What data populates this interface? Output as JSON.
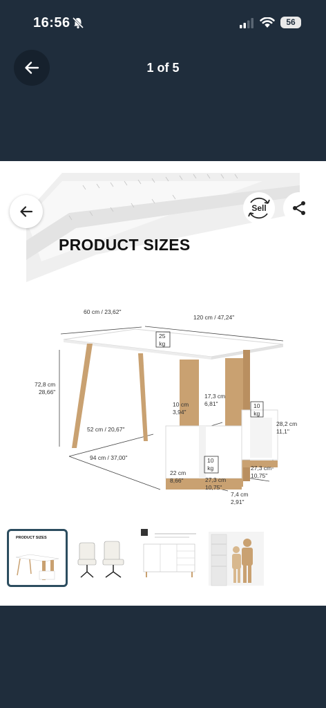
{
  "status_bar": {
    "time": "16:56",
    "battery": "56"
  },
  "header": {
    "counter": "1 of 5"
  },
  "image": {
    "title": "PRODUCT SIZES",
    "sell_label": "Sell",
    "dimensions": [
      "60 cm / 23,62\"",
      "120 cm / 47,24\"",
      "25\nkg",
      "72,8 cm\n28,66\"",
      "10 cm\n3,94\"",
      "17,3 cm\n6,81\"",
      "10\nkg",
      "52 cm / 20,67\"",
      "28,2 cm\n11,1\"",
      "10\nkg",
      "94 cm / 37,00\"",
      "22 cm\n8,66\"",
      "27,3 cm\n10,75\"",
      "27,3 cm\n10,75\"",
      "7,4 cm\n2,91\""
    ]
  },
  "thumbnails": [
    {
      "caption": "PRODUCT SIZES"
    }
  ],
  "colors": {
    "background": "#1f2d3c",
    "active_thumb_border": "#2c4d5f",
    "wood": "#c9a171"
  }
}
